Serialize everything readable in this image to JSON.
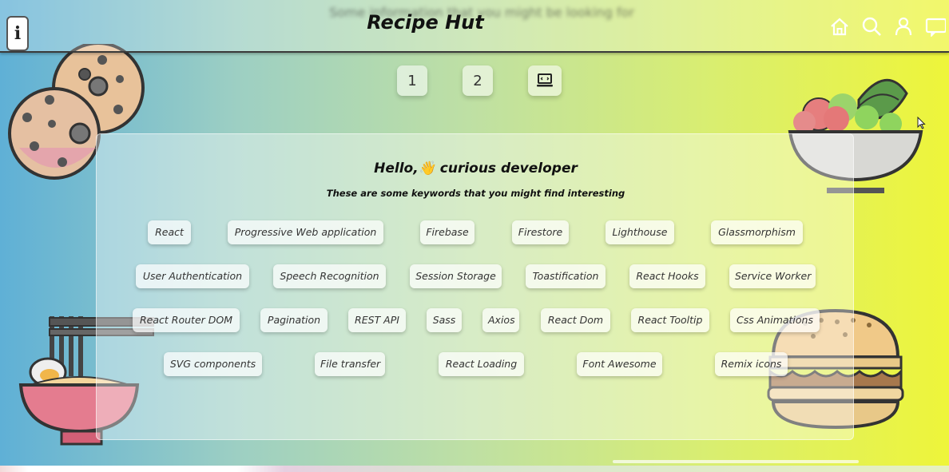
{
  "header": {
    "blurred_text": "Some information that you might be looking for",
    "title": "Recipe Hut",
    "info_label": "i"
  },
  "pagination": {
    "page1": "1",
    "page2": "2"
  },
  "card": {
    "greeting": "Hello,👋 curious developer",
    "subtitle": "These are some keywords that you might find interesting",
    "keywords": [
      "React",
      "Progressive Web application",
      "Firebase",
      "Firestore",
      "Lighthouse",
      "Glassmorphism",
      "User Authentication",
      "Speech Recognition",
      "Session Storage",
      "Toastification",
      "React Hooks",
      "Service Worker",
      "React Router DOM",
      "Pagination",
      "REST API",
      "Sass",
      "Axios",
      "React Dom",
      "React Tooltip",
      "Css Animations",
      "SVG components",
      "File transfer",
      "React Loading",
      "Font Awesome",
      "Remix icons"
    ]
  },
  "icons": {
    "home": "home-icon",
    "search": "search-icon",
    "user": "user-icon",
    "chat": "chat-icon",
    "laptop": "laptop-icon",
    "info": "info-icon"
  },
  "colors": {
    "gradient_left": "#5fb0d6",
    "gradient_right": "#eef53a"
  }
}
